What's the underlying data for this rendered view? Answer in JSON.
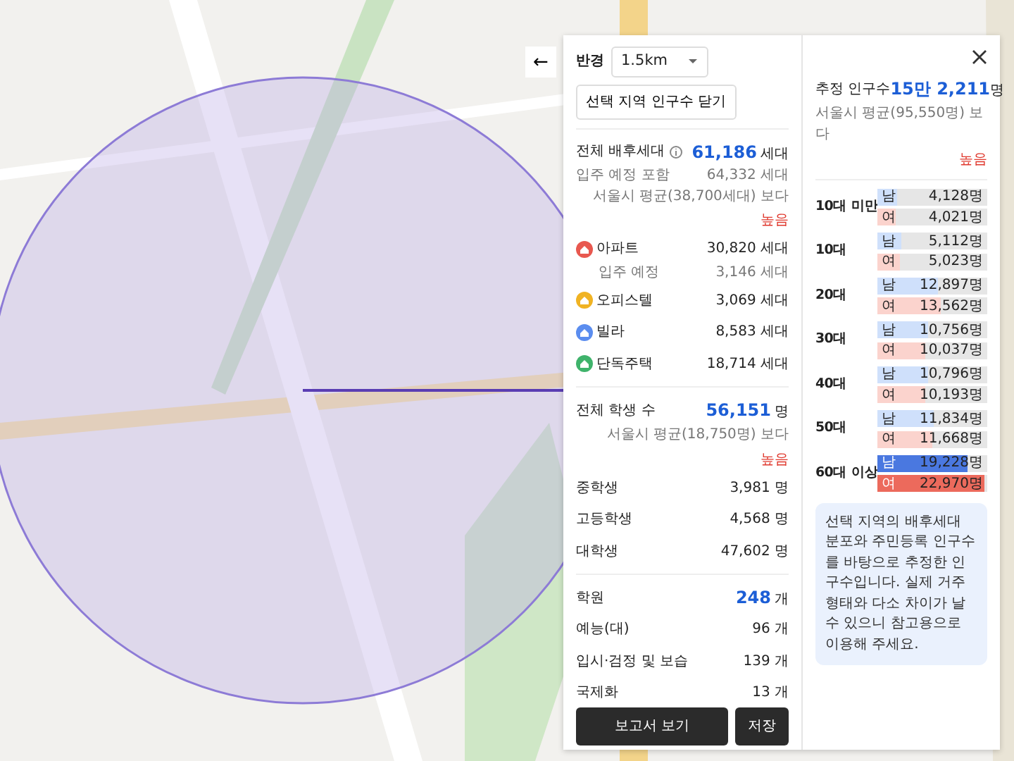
{
  "back_button": {
    "label": "←"
  },
  "radius": {
    "label": "반경",
    "value": "1.5km"
  },
  "close_area_button": {
    "label": "선택 지역 인구수 닫기"
  },
  "households": {
    "title": "전체 배후세대",
    "value": "61,186",
    "unit": "세대",
    "sub_label": "입주 예정 포함",
    "sub_value": "64,332 세대",
    "compare": "서울시 평균(38,700세대) 보다",
    "compare_badge": "높음",
    "types": [
      {
        "label": "아파트",
        "value": "30,820 세대",
        "color": "#e8584f",
        "sub_label": "입주 예정",
        "sub_value": "3,146 세대"
      },
      {
        "label": "오피스텔",
        "value": "3,069 세대",
        "color": "#f0b323"
      },
      {
        "label": "빌라",
        "value": "8,583 세대",
        "color": "#5b8def"
      },
      {
        "label": "단독주택",
        "value": "18,714 세대",
        "color": "#3fb36b"
      }
    ]
  },
  "students": {
    "title": "전체 학생 수",
    "value": "56,151",
    "unit": "명",
    "compare": "서울시 평균(18,750명) 보다",
    "compare_badge": "높음",
    "rows": [
      {
        "label": "중학생",
        "value": "3,981 명"
      },
      {
        "label": "고등학생",
        "value": "4,568 명"
      },
      {
        "label": "대학생",
        "value": "47,602 명"
      }
    ]
  },
  "academies": {
    "title": "학원",
    "value": "248",
    "unit": "개",
    "rows": [
      {
        "label": "예능(대)",
        "value": "96 개"
      },
      {
        "label": "입시·검정 및 보습",
        "value": "139 개"
      },
      {
        "label": "국제화",
        "value": "13 개"
      }
    ]
  },
  "buttons": [
    {
      "label": "보고서 보기"
    },
    {
      "label": "저장"
    }
  ],
  "population": {
    "title": "추정 인구수",
    "value": "15만 2,211",
    "unit": "명",
    "compare": "서울시 평균(95,550명) 보다",
    "compare_badge": "높음",
    "age_groups": [
      {
        "label": "10대 미만",
        "highlight": false,
        "male": {
          "label": "남",
          "value": "4,128명",
          "level": 0.18
        },
        "female": {
          "label": "여",
          "value": "4,021명",
          "level": 0.17
        }
      },
      {
        "label": "10대",
        "highlight": false,
        "male": {
          "label": "남",
          "value": "5,112명",
          "level": 0.22
        },
        "female": {
          "label": "여",
          "value": "5,023명",
          "level": 0.21
        }
      },
      {
        "label": "20대",
        "highlight": false,
        "male": {
          "label": "남",
          "value": "12,897명",
          "level": 0.55
        },
        "female": {
          "label": "여",
          "value": "13,562명",
          "level": 0.58
        }
      },
      {
        "label": "30대",
        "highlight": false,
        "male": {
          "label": "남",
          "value": "10,756명",
          "level": 0.46
        },
        "female": {
          "label": "여",
          "value": "10,037명",
          "level": 0.43
        }
      },
      {
        "label": "40대",
        "highlight": false,
        "male": {
          "label": "남",
          "value": "10,796명",
          "level": 0.46
        },
        "female": {
          "label": "여",
          "value": "10,193명",
          "level": 0.44
        }
      },
      {
        "label": "50대",
        "highlight": false,
        "male": {
          "label": "남",
          "value": "11,834명",
          "level": 0.51
        },
        "female": {
          "label": "여",
          "value": "11,668명",
          "level": 0.5
        }
      },
      {
        "label": "60대 이상",
        "highlight": true,
        "male": {
          "label": "남",
          "value": "19,228명",
          "level": 0.82
        },
        "female": {
          "label": "여",
          "value": "22,970명",
          "level": 0.98
        }
      }
    ],
    "note": "선택 지역의 배후세대 분포와 주민등록 인구수를 바탕으로 추정한 인구수입니다. 실제 거주 형태와 다소 차이가 날 수 있으니 참고용으로 이용해 주세요."
  }
}
